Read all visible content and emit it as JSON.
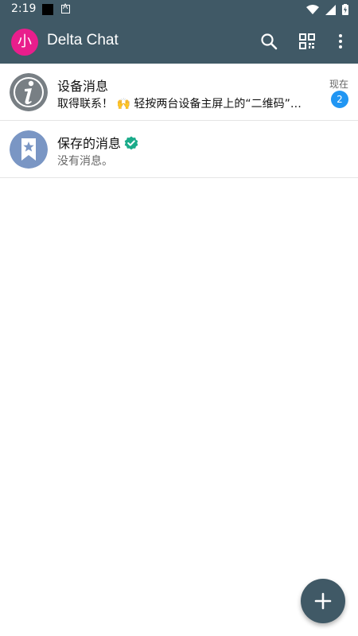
{
  "status_bar": {
    "time": "2:19"
  },
  "app_bar": {
    "avatar_letter": "小",
    "title": "Delta Chat"
  },
  "chats": [
    {
      "title": "设备消息",
      "preview": "取得联系！ 🙌 轻按两台设备主屏上的“二维码”。 ...",
      "time": "现在",
      "unread": "2"
    },
    {
      "title": "保存的消息",
      "preview": "没有消息。"
    }
  ],
  "colors": {
    "primary": "#405966",
    "avatar_me": "#e91e8c",
    "badge": "#2196f3",
    "verified": "#1aab8a",
    "saved_avatar": "#7a96c4",
    "info_avatar": "#787f84"
  }
}
